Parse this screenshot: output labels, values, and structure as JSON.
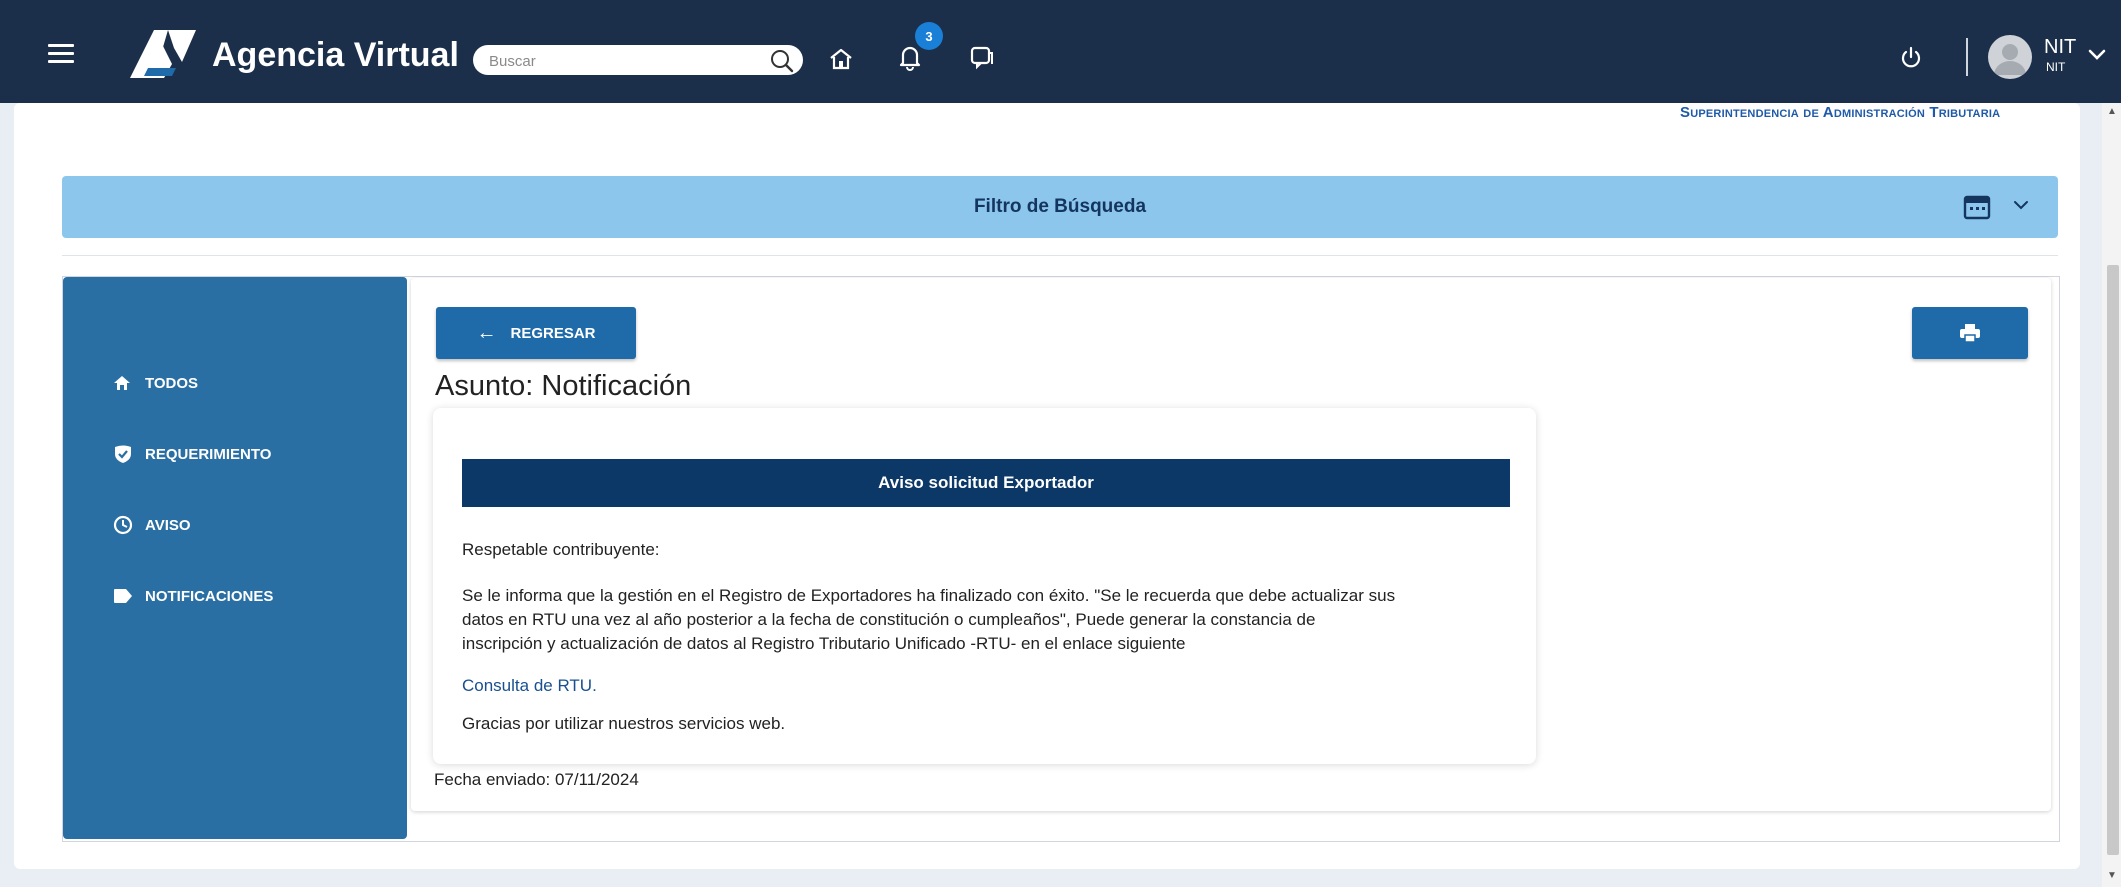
{
  "navbar": {
    "brand": "Agencia Virtual",
    "search_placeholder": "Buscar",
    "notification_count": "3",
    "user_name": "NIT",
    "user_sub": "NIT",
    "icons": [
      "menu-icon",
      "search-icon",
      "home-icon",
      "bell-icon",
      "chat-icon",
      "power-icon",
      "chevron-down-icon"
    ]
  },
  "header": {
    "institution": "Superintendencia de Administración Tributaria"
  },
  "filter": {
    "title": "Filtro de Búsqueda"
  },
  "sidebar": {
    "items": [
      {
        "label": "TODOS",
        "icon": "home-icon"
      },
      {
        "label": "REQUERIMIENTO",
        "icon": "shield-check-icon"
      },
      {
        "label": "AVISO",
        "icon": "clock-icon"
      },
      {
        "label": "NOTIFICACIONES",
        "icon": "tag-icon"
      }
    ]
  },
  "detail": {
    "back_label": "REGRESAR",
    "subject": "Asunto: Notificación",
    "notice_title": "Aviso solicitud Exportador",
    "greeting": "Respetable contribuyente:",
    "body_line1": "Se le informa que la gestión en el Registro de Exportadores ha finalizado con éxito. \"Se le recuerda que debe actualizar sus",
    "body_line2": "datos en RTU una vez al año posterior a la fecha de constitución o cumpleaños\", Puede generar la constancia de",
    "body_line3": "inscripción y actualización de datos al Registro Tributario Unificado -RTU- en el enlace siguiente",
    "link_text": "Consulta de RTU.",
    "thanks": "Gracias por utilizar nuestros servicios web.",
    "sent_date": "Fecha enviado: 07/11/2024"
  },
  "colors": {
    "navbar": "#1c2f4a",
    "sidebar": "#2a6fa3",
    "filter_bar": "#8cc6ec",
    "notice_header": "#0c3868",
    "button": "#1f6aa8"
  }
}
